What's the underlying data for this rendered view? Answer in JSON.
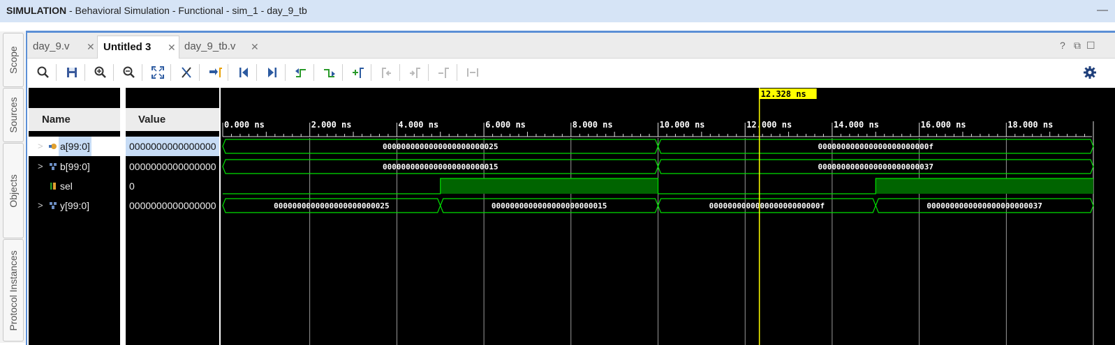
{
  "window": {
    "title_bold": "SIMULATION",
    "title_rest": " - Behavioral Simulation - Functional - sim_1 - day_9_tb"
  },
  "side_tabs": [
    "Scope",
    "Sources",
    "Objects",
    "Protocol Instances"
  ],
  "tabs": [
    {
      "label": "day_9.v",
      "active": false
    },
    {
      "label": "Untitled 3",
      "active": true
    },
    {
      "label": "day_9_tb.v",
      "active": false
    }
  ],
  "toolbar": {
    "buttons": [
      "search",
      "save",
      "zoom-in",
      "zoom-out",
      "zoom-fit",
      "cursor-to-zero",
      "go-to-cursor",
      "go-to-start",
      "go-to-end",
      "previous-transition",
      "next-transition",
      "add-marker",
      "previous-marker",
      "next-marker",
      "swap-cursors",
      "snap"
    ],
    "settings_icon": "gear"
  },
  "columns": {
    "name": "Name",
    "value": "Value"
  },
  "cursor_time": "12.328 ns",
  "time_ticks": [
    "0.000 ns",
    "2.000 ns",
    "4.000 ns",
    "6.000 ns",
    "8.000 ns",
    "10.000 ns",
    "12.000 ns",
    "14.000 ns",
    "16.000 ns",
    "18.000 ns"
  ],
  "signals": [
    {
      "name": "a[99:0]",
      "value": "0000000000000000",
      "type": "bus-in",
      "expandable": true,
      "selected": true,
      "segments": [
        {
          "from": 0,
          "to": 10,
          "label": "0000000000000000000000025"
        },
        {
          "from": 10,
          "to": 20,
          "label": "000000000000000000000000f"
        }
      ]
    },
    {
      "name": "b[99:0]",
      "value": "0000000000000000",
      "type": "bus",
      "expandable": true,
      "selected": false,
      "segments": [
        {
          "from": 0,
          "to": 10,
          "label": "0000000000000000000000015"
        },
        {
          "from": 10,
          "to": 20,
          "label": "0000000000000000000000037"
        }
      ]
    },
    {
      "name": "sel",
      "value": "0",
      "type": "bit",
      "expandable": false,
      "selected": false,
      "levels": [
        {
          "from": 0,
          "to": 5,
          "v": 0
        },
        {
          "from": 5,
          "to": 10,
          "v": 1
        },
        {
          "from": 10,
          "to": 15,
          "v": 0
        },
        {
          "from": 15,
          "to": 20,
          "v": 1
        }
      ]
    },
    {
      "name": "y[99:0]",
      "value": "0000000000000000",
      "type": "bus",
      "expandable": true,
      "selected": false,
      "segments": [
        {
          "from": 0,
          "to": 5,
          "label": "0000000000000000000000025"
        },
        {
          "from": 5,
          "to": 10,
          "label": "0000000000000000000000015"
        },
        {
          "from": 10,
          "to": 15,
          "label": "000000000000000000000000f"
        },
        {
          "from": 15,
          "to": 20,
          "label": "0000000000000000000000037"
        }
      ]
    }
  ],
  "colors": {
    "wave": "#00e000",
    "wave_fill": "#006400",
    "cursor": "#ffff00",
    "background": "#000000",
    "grid": "#bfbfbf"
  }
}
